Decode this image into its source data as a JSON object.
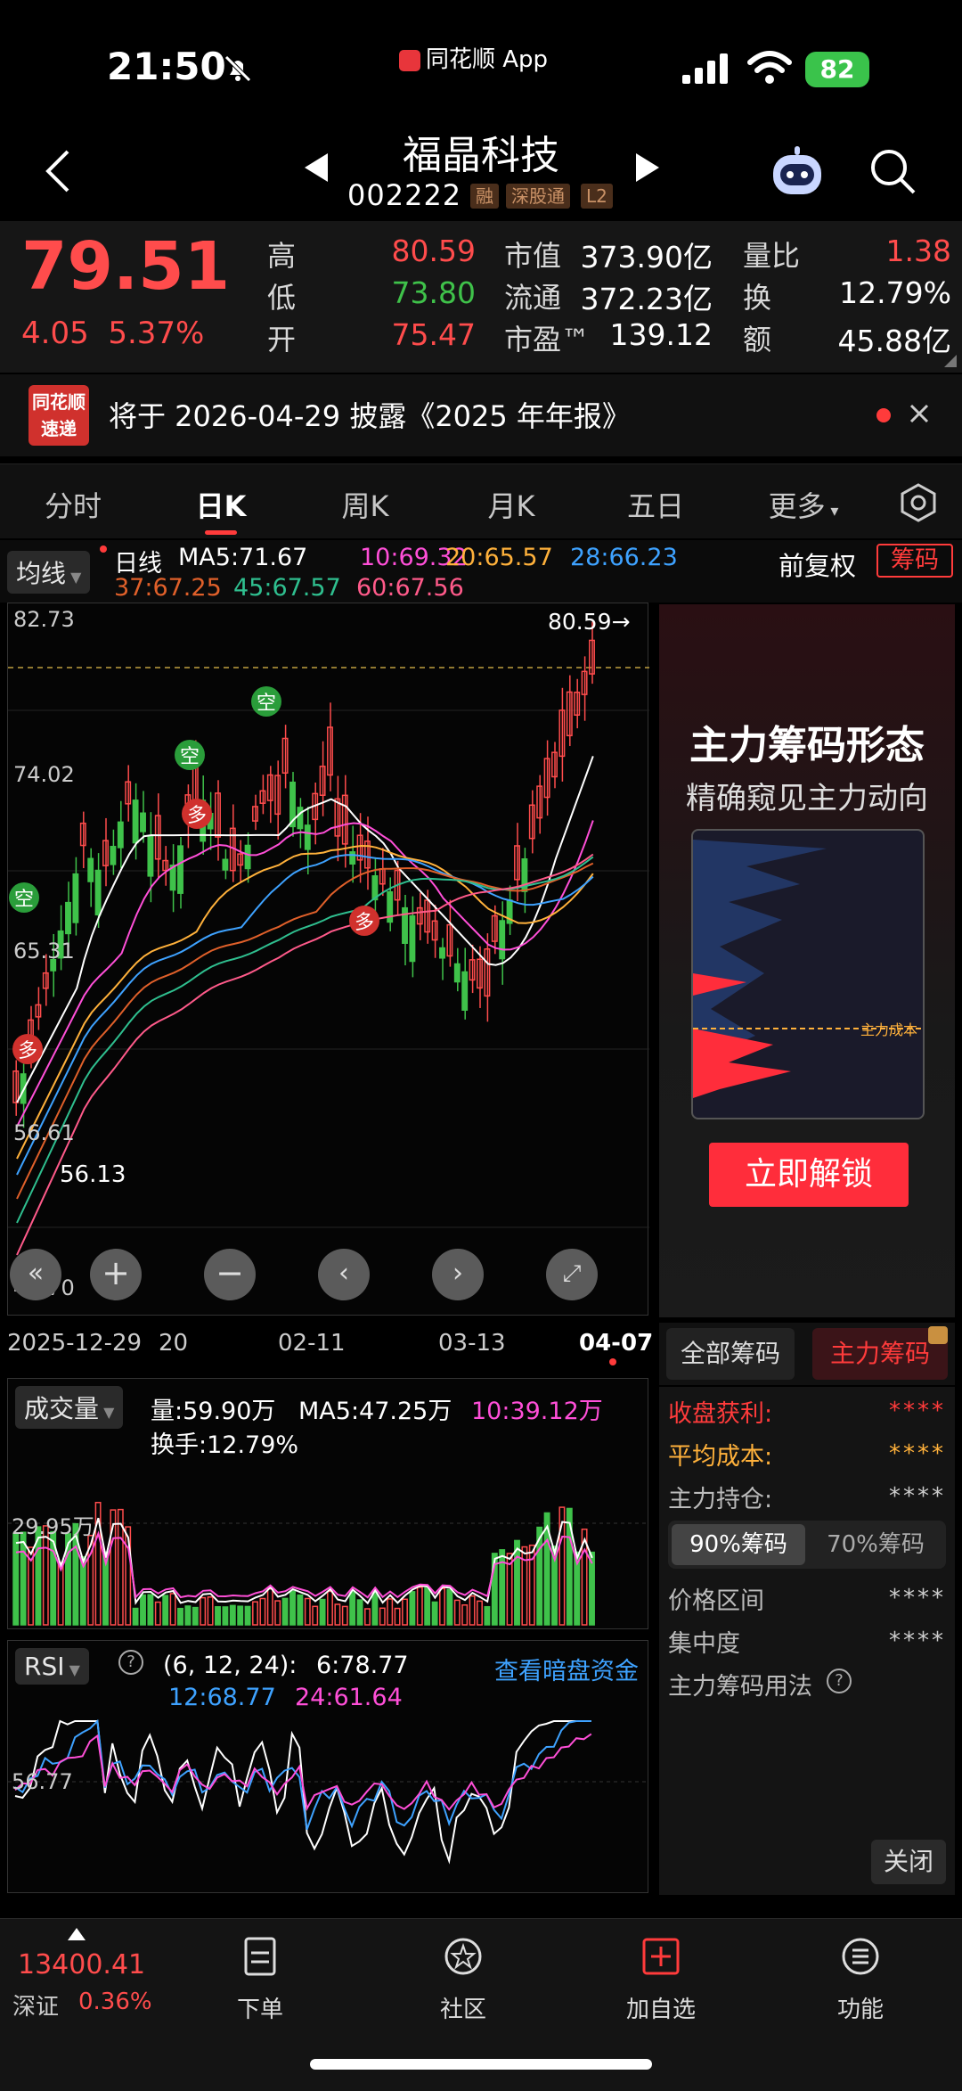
{
  "status": {
    "time": "21:50",
    "app": "同花顺 App",
    "battery": "82"
  },
  "header": {
    "name": "福晶科技",
    "code": "002222",
    "tags": [
      "融",
      "深股通",
      "L2"
    ]
  },
  "quote": {
    "price": "79.51",
    "change": "4.05",
    "change_pct": "5.37%",
    "rows": [
      {
        "l1": "高",
        "v1": "80.59",
        "c1": "red",
        "l2": "市值",
        "v2": "373.90亿",
        "l3": "量比",
        "v3": "1.38",
        "c3": "red"
      },
      {
        "l1": "低",
        "v1": "73.80",
        "c1": "green",
        "l2": "流通",
        "v2": "372.23亿",
        "l3": "换",
        "v3": "12.79%",
        "c3": "white"
      },
      {
        "l1": "开",
        "v1": "75.47",
        "c1": "red",
        "l2": "市盈™",
        "v2": "139.12",
        "l3": "额",
        "v3": "45.88亿",
        "c3": "white"
      }
    ]
  },
  "news": {
    "logo_top": "同花顺",
    "logo_bottom": "速递",
    "text": "将于 2026-04-29 披露《2025 年年报》"
  },
  "tabs": [
    "分时",
    "日K",
    "周K",
    "月K",
    "五日",
    "更多"
  ],
  "ma": {
    "selector": "均线",
    "period": "日线",
    "ma5": "MA5:71.67",
    "ma10": "10:69.32",
    "ma20": "20:65.57",
    "ma28": "28:66.23",
    "ma37": "37:67.25",
    "ma45": "45:67.57",
    "ma60": "60:67.56",
    "adjust": "前复权",
    "chip_btn": "筹码",
    "colors": {
      "ma5": "#ffffff",
      "ma10": "#ff4fd8",
      "ma20": "#ffb13b",
      "ma28": "#3ea2ff",
      "ma37": "#e0602a",
      "ma45": "#2fbf8f",
      "ma60": "#ff5a8a"
    }
  },
  "kline": {
    "y_labels": [
      "82.73",
      "74.02",
      "65.31",
      "56.61",
      "47.70"
    ],
    "high_label": "80.59→",
    "low_label": "56.13",
    "signals": [
      "空",
      "空",
      "空",
      "多",
      "多",
      "多"
    ]
  },
  "dates": [
    "2025-12-29",
    "20",
    "02-11",
    "03-13",
    "04-07"
  ],
  "promo": {
    "title": "主力筹码形态",
    "subtitle": "精确窥见主力动向",
    "cost_label": "主力成本",
    "button": "立即解锁"
  },
  "chip_tabs": [
    "全部筹码",
    "主力筹码"
  ],
  "chip_list": {
    "profit_label": "收盘获利:",
    "profit_val": "****",
    "avgcost_label": "平均成本:",
    "avgcost_val": "****",
    "hold_label": "主力持仓:",
    "hold_val": "****",
    "toggle": [
      "90%筹码",
      "70%筹码"
    ],
    "range_label": "价格区间",
    "range_val": "****",
    "conc_label": "集中度",
    "conc_val": "****",
    "usage": "主力筹码用法",
    "close": "关闭"
  },
  "volume": {
    "selector": "成交量",
    "vol": "量:59.90万",
    "ma5": "MA5:47.25万",
    "ma10": "10:39.12万",
    "turnover": "换手:12.79%",
    "y_label": "29.95万"
  },
  "rsi": {
    "selector": "RSI",
    "params": "(6, 12, 24):",
    "rsi6": "6:78.77",
    "rsi12": "12:68.77",
    "rsi24": "24:61.64",
    "link": "查看暗盘资金",
    "y_label": "56.77"
  },
  "bottom": {
    "index_value": "13400.41",
    "index_name": "深证",
    "index_pct": "0.36%",
    "items": [
      "下单",
      "社区",
      "加自选",
      "功能"
    ]
  }
}
